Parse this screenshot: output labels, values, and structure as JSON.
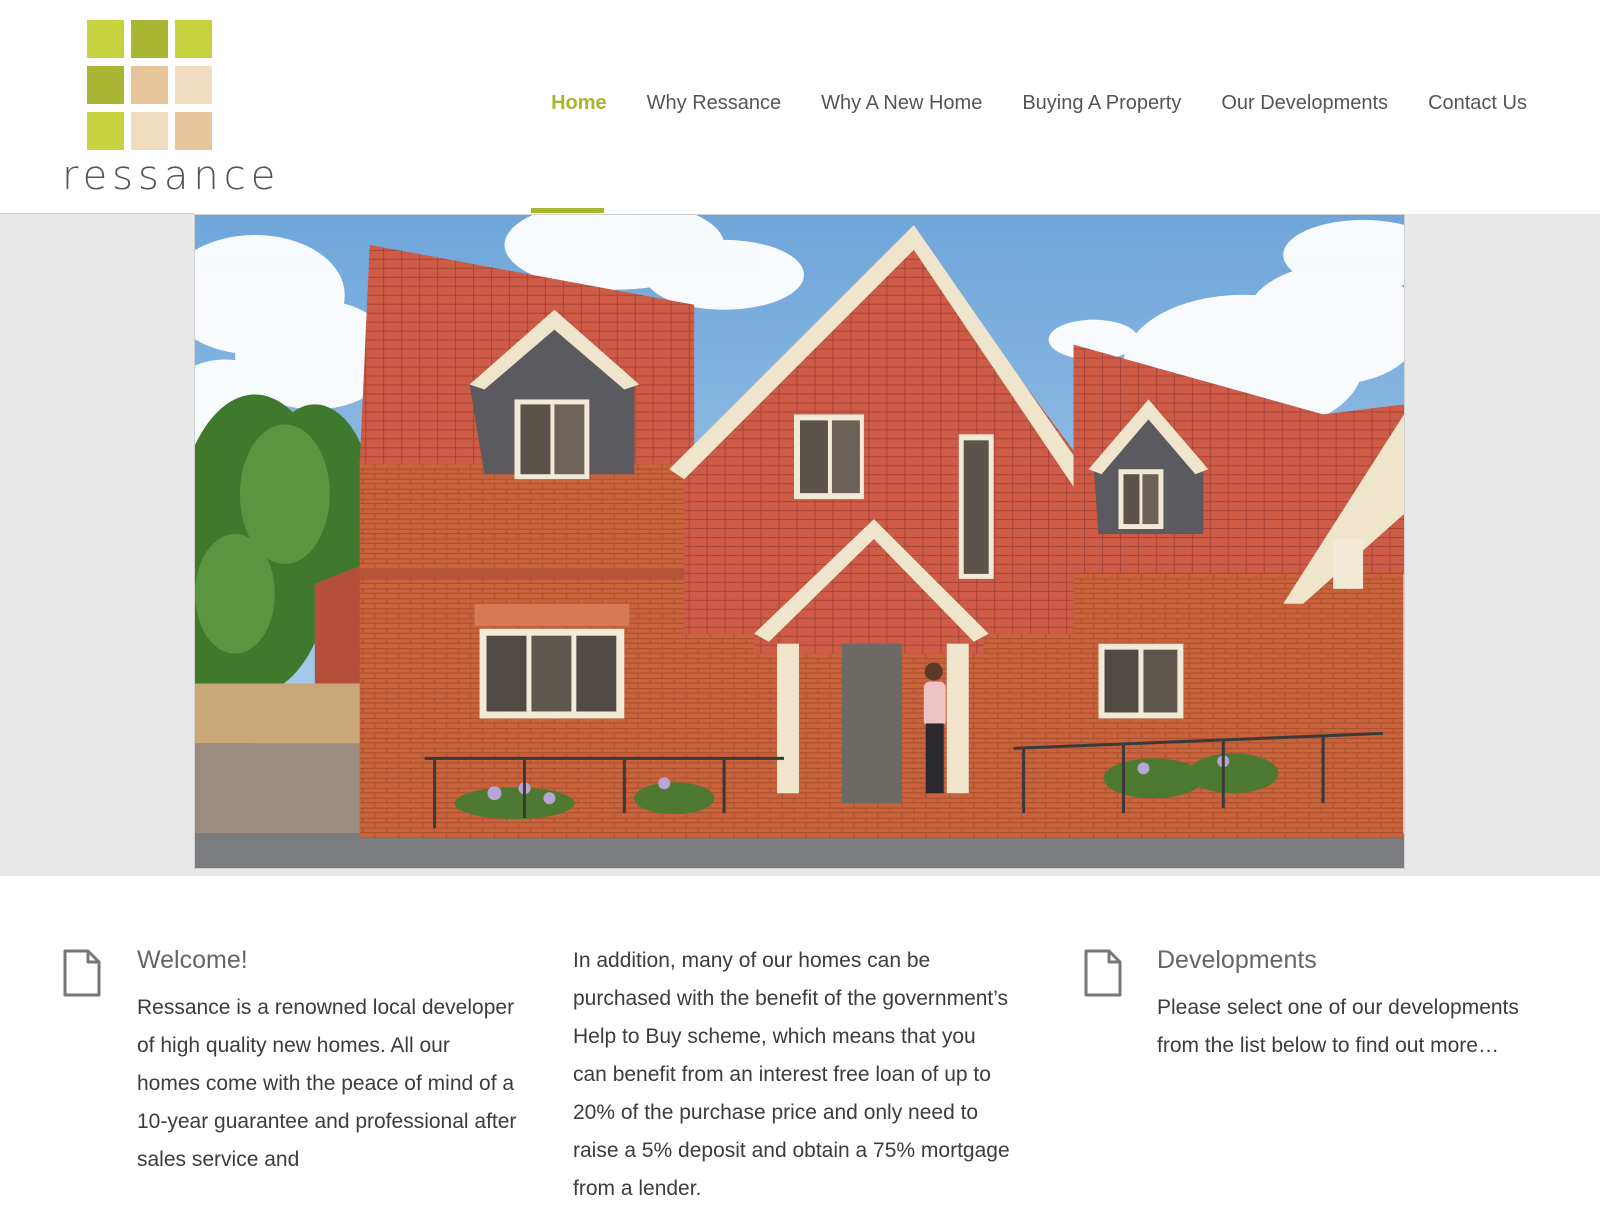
{
  "brand": {
    "logo_text": "ressance",
    "colors": {
      "accent": "#a7b62c",
      "green_light": "#c6d23e",
      "green_dark": "#a7b62c",
      "tan": "#e6c59a",
      "beige": "#f0dcc0"
    }
  },
  "nav": {
    "items": [
      {
        "label": "Home",
        "active": true
      },
      {
        "label": "Why Ressance",
        "active": false
      },
      {
        "label": "Why A New Home",
        "active": false
      },
      {
        "label": "Buying A Property",
        "active": false
      },
      {
        "label": "Our Developments",
        "active": false
      },
      {
        "label": "Contact Us",
        "active": false
      }
    ]
  },
  "content": {
    "welcome": {
      "icon": "document-icon",
      "title": "Welcome!",
      "text": "Ressance is a renowned local developer of high quality new homes. All our homes come with the peace of mind of a 10-year guarantee and professional after sales service and"
    },
    "middle": {
      "text": "In addition, many of our homes can be purchased with the benefit of the government’s Help to Buy scheme, which means that you can benefit from an interest free loan of up to 20% of the purchase price and only need to raise a 5% deposit and obtain a 75% mortgage from a lender."
    },
    "developments": {
      "icon": "document-icon",
      "title": "Developments",
      "text": "Please select one of our developments from the list below to find out more…"
    }
  }
}
